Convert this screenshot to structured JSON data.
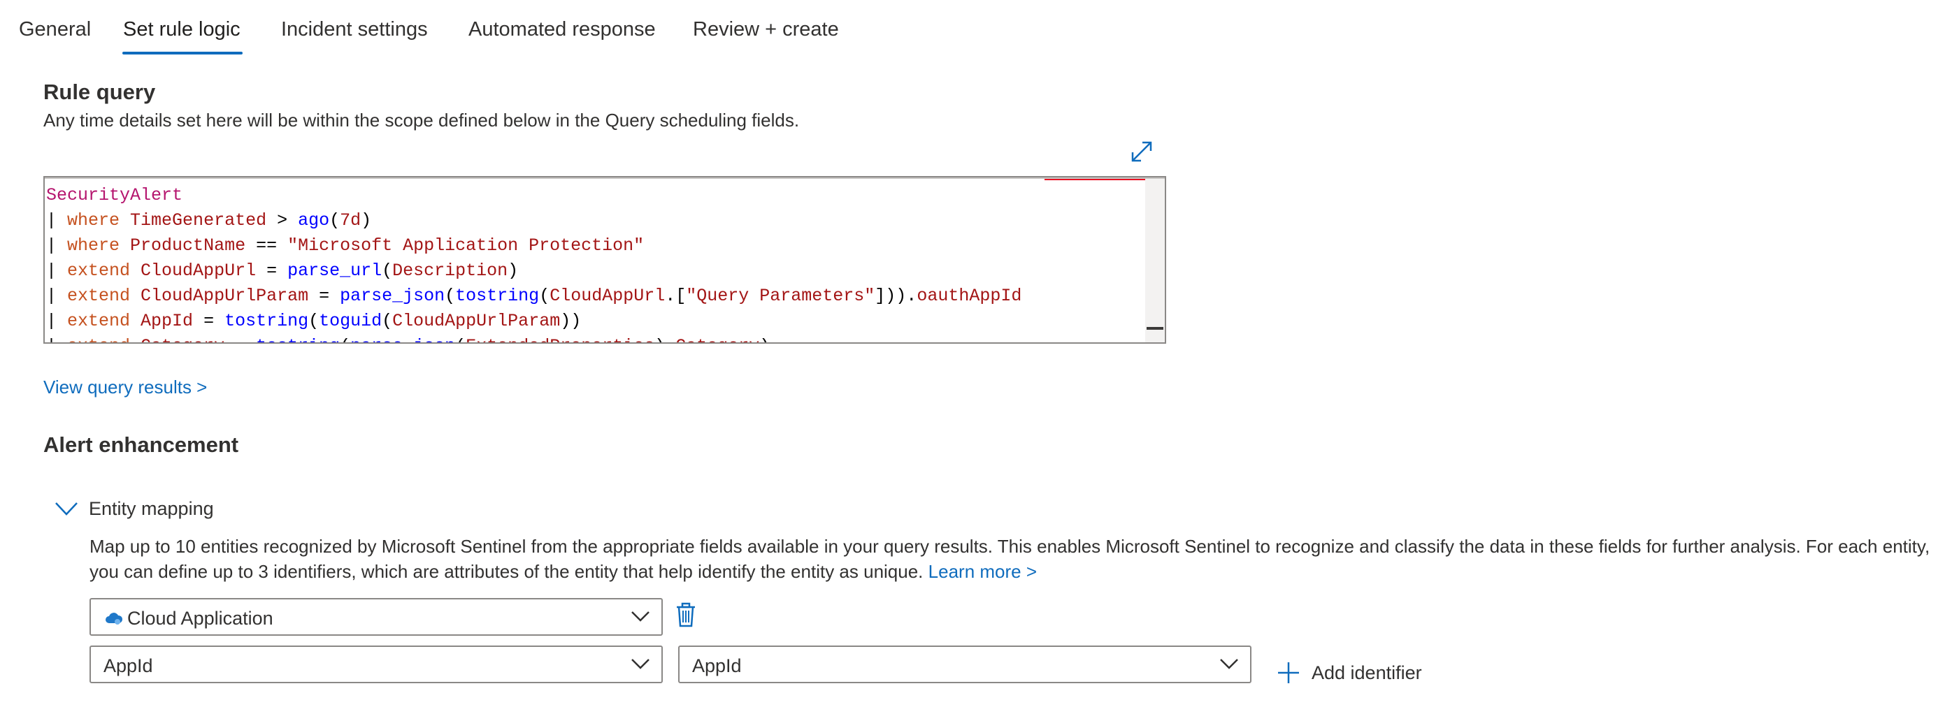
{
  "tabs": [
    {
      "label": "General"
    },
    {
      "label": "Set rule logic"
    },
    {
      "label": "Incident settings"
    },
    {
      "label": "Automated response"
    },
    {
      "label": "Review + create"
    }
  ],
  "rule_query": {
    "title": "Rule query",
    "description": "Any time details set here will be within the scope defined below in the Query scheduling fields.",
    "code_lines": [
      "SecurityAlert",
      "| where TimeGenerated > ago(7d)",
      "| where ProductName == \"Microsoft Application Protection\"",
      "| extend CloudAppUrl = parse_url(Description)",
      "| extend CloudAppUrlParam = parse_json(tostring(CloudAppUrl.[\"Query Parameters\"])).oauthAppId",
      "| extend AppId = tostring(toguid(CloudAppUrlParam))",
      "| extend Category = tostring(parse_json(ExtendedProperties).Category)"
    ],
    "view_results_link": "View query results >"
  },
  "alert_enhancement": {
    "title": "Alert enhancement",
    "entity_mapping": {
      "label": "Entity mapping",
      "description": "Map up to 10 entities recognized by Microsoft Sentinel from the appropriate fields available in your query results. This enables Microsoft Sentinel to recognize and classify the data in these fields for further analysis. For each entity, you can define up to 3 identifiers, which are attributes of the entity that help identify the entity as unique.",
      "learn_more": "Learn more >",
      "entity_type": "Cloud Application",
      "identifier": "AppId",
      "column": "AppId",
      "add_identifier": "Add identifier"
    }
  },
  "colors": {
    "accent": "#0f6cbd",
    "text": "#323130",
    "border": "#8a8886"
  },
  "icons": [
    "expand-icon",
    "chevron-down-icon",
    "cloud-icon",
    "trash-icon",
    "plus-icon"
  ]
}
